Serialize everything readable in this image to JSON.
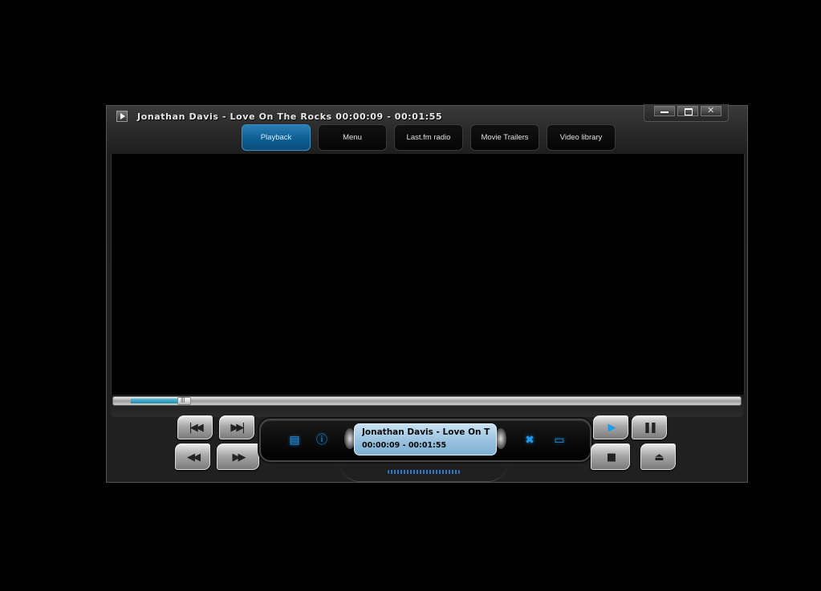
{
  "window": {
    "title": "Jonathan Davis - Love On The Rocks  00:00:09 - 00:01:55",
    "controls": {
      "minimize": "minimize",
      "maximize": "maximize",
      "close": "close"
    }
  },
  "tabs": [
    {
      "label": "Playback",
      "active": true
    },
    {
      "label": "Menu",
      "active": false
    },
    {
      "label": "Last.fm radio",
      "active": false
    },
    {
      "label": "Movie Trailers",
      "active": false
    },
    {
      "label": "Video library",
      "active": false
    }
  ],
  "seek": {
    "elapsed": "00:00:09",
    "duration": "00:01:55",
    "progress_fraction": 0.078
  },
  "display": {
    "track_line": "Jonathan Davis - Love On Th",
    "time_line": "00:00:09 - 00:01:55"
  },
  "transport": {
    "prev_track": "previous-track",
    "next_track": "next-track",
    "rewind": "rewind",
    "fast_forward": "fast-forward",
    "play": "play",
    "pause": "pause",
    "stop": "stop",
    "eject": "eject"
  },
  "pod_icons": [
    "playlist-icon",
    "info-icon",
    "settings-icon",
    "window-icon"
  ],
  "colors": {
    "accent": "#1d9cf2",
    "active_tab": "#0e5f93",
    "seek_fill": "#2aa0c2",
    "lcd": "#a9cde6"
  }
}
